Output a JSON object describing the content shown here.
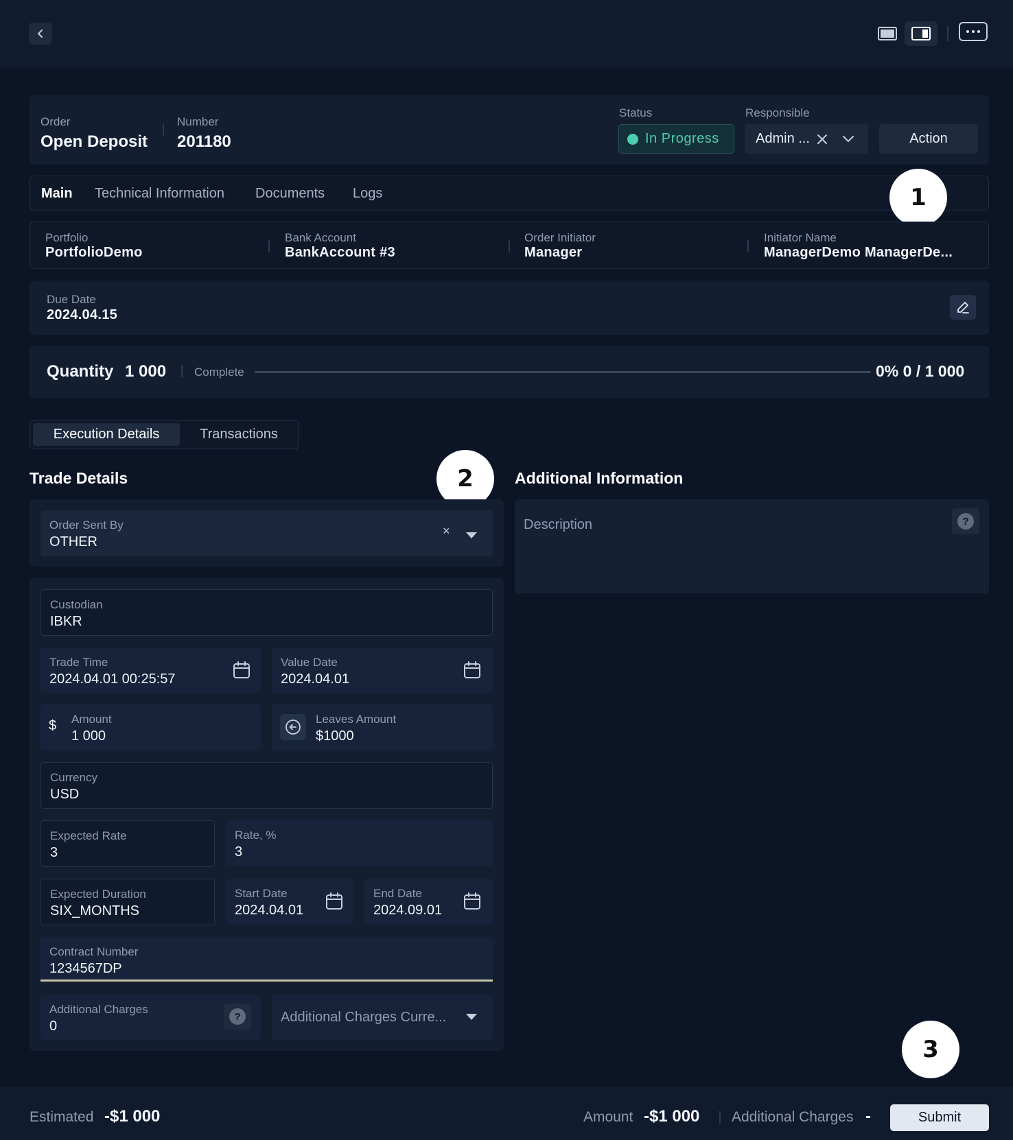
{
  "header": {
    "order_label": "Order",
    "order_value": "Open Deposit",
    "number_label": "Number",
    "number_value": "201180",
    "status_label": "Status",
    "status_value": "In Progress",
    "responsible_label": "Responsible",
    "responsible_value": "Admin ...",
    "action_label": "Action"
  },
  "tabs": [
    "Main",
    "Technical Information",
    "Documents",
    "Logs"
  ],
  "info": {
    "portfolio_label": "Portfolio",
    "portfolio_value": "PortfolioDemo",
    "bank_label": "Bank Account",
    "bank_value": "BankAccount #3",
    "initiator_label": "Order Initiator",
    "initiator_value": "Manager",
    "initiator_name_label": "Initiator Name",
    "initiator_name_value": "ManagerDemo ManagerDe..."
  },
  "due": {
    "label": "Due Date",
    "value": "2024.04.15"
  },
  "quantity": {
    "label": "Quantity",
    "value": "1 000",
    "complete_label": "Complete",
    "progress_text": "0% 0 / 1 000",
    "progress_fraction": 0
  },
  "subtabs": [
    "Execution Details",
    "Transactions"
  ],
  "trade": {
    "title": "Trade Details",
    "order_sent_label": "Order Sent By",
    "order_sent_value": "OTHER",
    "clear_glyph": "×",
    "custodian_label": "Custodian",
    "custodian_value": "IBKR",
    "trade_time_label": "Trade Time",
    "trade_time_value": "2024.04.01 00:25:57",
    "value_date_label": "Value Date",
    "value_date_value": "2024.04.01",
    "currency_symbol": "$",
    "amount_label": "Amount",
    "amount_value": "1 000",
    "leaves_label": "Leaves Amount",
    "leaves_value": "$1000",
    "currency_label": "Currency",
    "currency_value": "USD",
    "exp_rate_label": "Expected Rate",
    "exp_rate_value": "3",
    "rate_label": "Rate, %",
    "rate_value": "3",
    "exp_duration_label": "Expected Duration",
    "exp_duration_value": "SIX_MONTHS",
    "start_label": "Start Date",
    "start_value": "2024.04.01",
    "end_label": "End Date",
    "end_value": "2024.09.01",
    "contract_label": "Contract Number",
    "contract_value": "1234567DP",
    "add_charges_label": "Additional Charges",
    "add_charges_value": "0",
    "add_charges_currency_placeholder": "Additional Charges Curre..."
  },
  "additional": {
    "title": "Additional Information",
    "description_placeholder": "Description",
    "help_glyph": "?"
  },
  "callouts": [
    "1",
    "2",
    "3"
  ],
  "footer": {
    "estimated_label": "Estimated",
    "estimated_value": "-$1 000",
    "amount_label": "Amount",
    "amount_value": "-$1 000",
    "charges_label": "Additional Charges",
    "charges_value": "-",
    "submit_label": "Submit"
  },
  "colors": {
    "background": "#0c1526",
    "panel": "#131e31",
    "status_accent": "#4fcdb0",
    "contract_underline": "#c9c5a8"
  }
}
